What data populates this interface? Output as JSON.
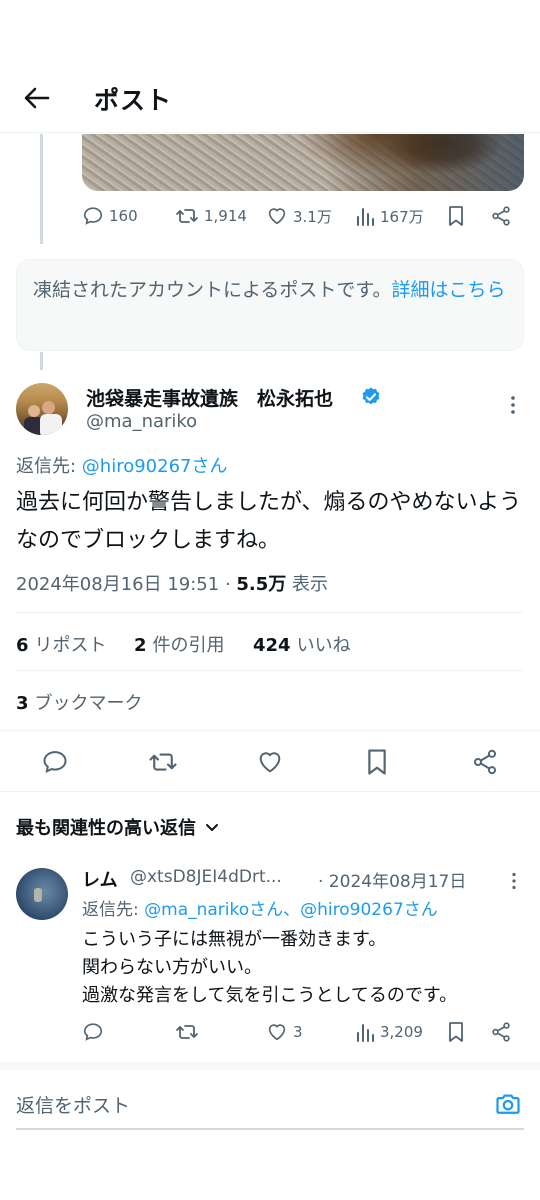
{
  "header": {
    "title": "ポスト"
  },
  "quoted_post": {
    "actions": {
      "replies": "160",
      "reposts": "1,914",
      "likes": "3.1万",
      "views": "167万"
    }
  },
  "notice": {
    "text": "凍結されたアカウントによるポストです。",
    "link": "詳細はこちら"
  },
  "main_post": {
    "author_name": "池袋暴走事故遺族　松永拓也",
    "author_handle": "@ma_nariko",
    "reply_to_label": "返信先: ",
    "reply_to_handle": "@hiro90267さん",
    "text": "過去に何回か警告しましたが、煽るのやめないようなのでブロックしますね。",
    "timestamp": "2024年08月16日 19:51",
    "separator": " · ",
    "views_count": "5.5万",
    "views_label": " 表示",
    "reposts_count": "6",
    "reposts_label": "リポスト",
    "quotes_count": "2",
    "quotes_label": "件の引用",
    "likes_count": "424",
    "likes_label": "いいね",
    "bookmarks_count": "3",
    "bookmarks_label": "ブックマーク"
  },
  "sort": {
    "label": "最も関連性の高い返信"
  },
  "reply": {
    "name": "レム",
    "handle": "@xtsD8JEI4dDrt...",
    "date": "· 2024年08月17日",
    "reply_to_label": "返信先: ",
    "reply_to_handles": "@ma_narikoさん、@hiro90267さん",
    "lines": [
      "こういう子には無視が一番効きます。",
      "関わらない方がいい。",
      "過激な発言をして気を引こうとしてるのです。"
    ],
    "actions": {
      "replies": "",
      "reposts": "",
      "likes": "3",
      "views": "3,209"
    }
  },
  "compose": {
    "placeholder": "返信をポスト"
  },
  "colors": {
    "accent": "#1d9bf0",
    "muted": "#536471",
    "text": "#0f1419"
  }
}
